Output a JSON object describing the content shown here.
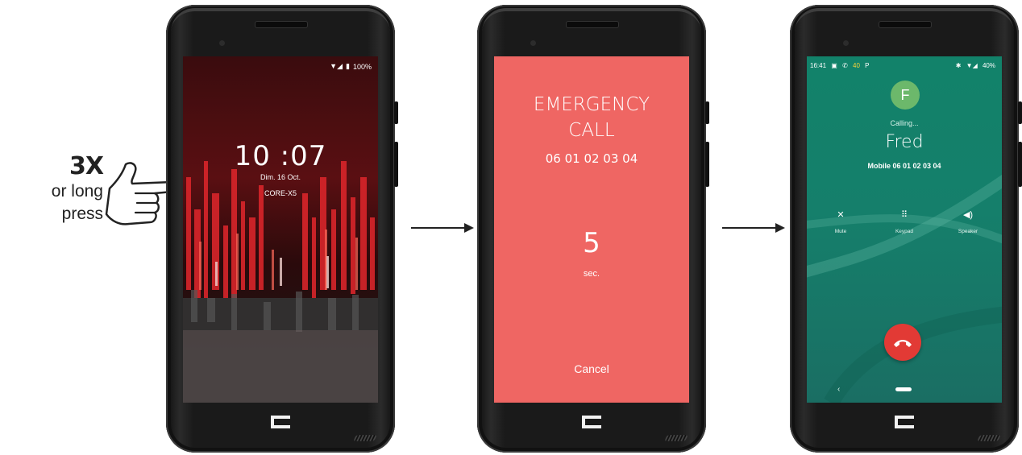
{
  "instruction": {
    "count": "3X",
    "line1": "or long",
    "line2": "press"
  },
  "lock_screen": {
    "battery": "100%",
    "time": "10 :07",
    "date": "Dim. 16 Oct.",
    "model": "CORE-X5"
  },
  "emergency_screen": {
    "title_line1": "EMERGENCY",
    "title_line2": "CALL",
    "number": "06 01 02 03 04",
    "countdown": "5",
    "unit": "sec.",
    "cancel": "Cancel",
    "background": "#ef6663"
  },
  "calling_screen": {
    "status_time": "16:41",
    "status_num": "40",
    "status_battery": "40%",
    "avatar_letter": "F",
    "status_label": "Calling...",
    "contact_name": "Fred",
    "contact_detail": "Mobile 06 01 02 03 04",
    "controls": [
      {
        "icon": "mute-icon",
        "label": "Mute"
      },
      {
        "icon": "keypad-icon",
        "label": "Keypad"
      },
      {
        "icon": "speaker-icon",
        "label": "Speaker"
      }
    ],
    "accent": "#12826a",
    "end_call_color": "#e23a35"
  }
}
